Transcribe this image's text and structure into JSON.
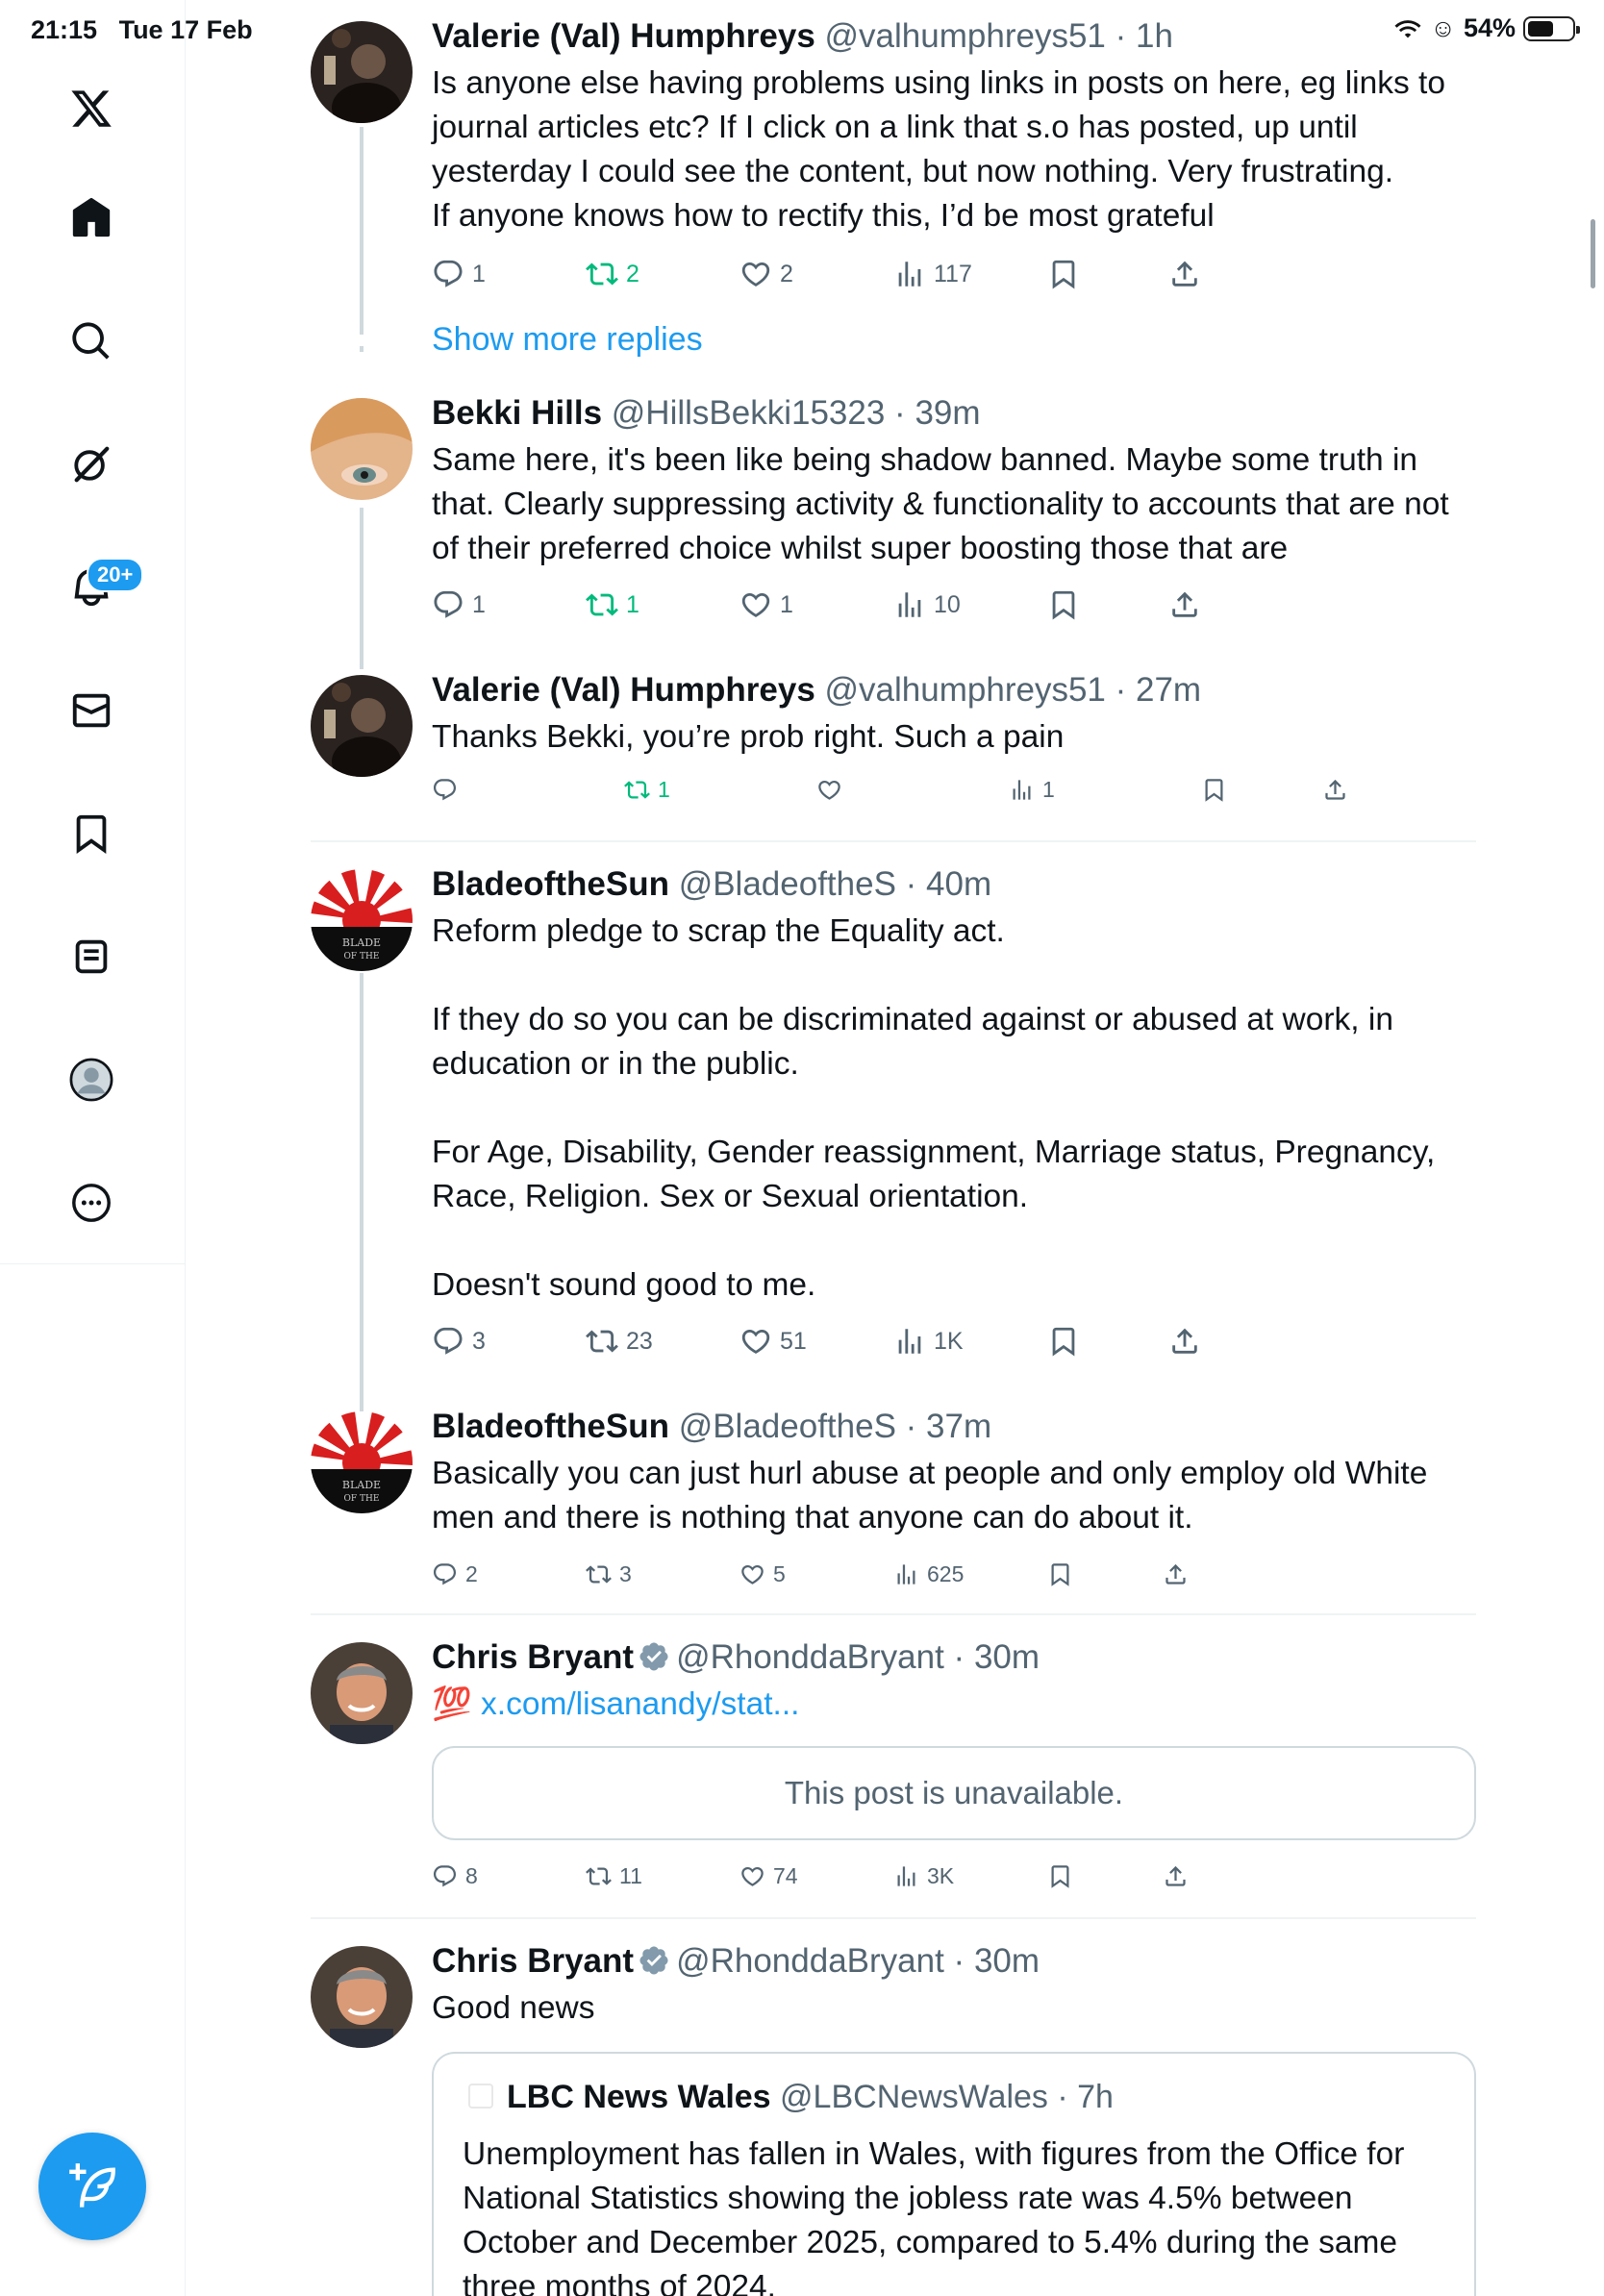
{
  "status": {
    "time": "21:15",
    "date": "Tue 17 Feb",
    "battery": "54%"
  },
  "sidebar": {
    "items": [
      "x-logo",
      "home",
      "explore",
      "grok",
      "notifications",
      "messages",
      "bookmarks",
      "lists",
      "profile",
      "more"
    ],
    "notifications_badge": "20+"
  },
  "posts": [
    {
      "name": "Valerie (Val) Humphreys",
      "handle": "@valhumphreys51",
      "time": "1h",
      "text": "Is anyone else having problems using links in posts on here, eg links to journal articles etc? If I click on a link that s.o has posted, up until yesterday I could see the content, but now nothing. Very frustrating.\nIf anyone knows how to rectify this, I’d be most grateful",
      "replies": "1",
      "reposts": "2",
      "likes": "2",
      "views": "117"
    },
    {
      "show_more": "Show more replies"
    },
    {
      "name": "Bekki Hills",
      "handle": "@HillsBekki15323",
      "time": "39m",
      "text": "Same here, it's been like being shadow banned. Maybe some truth in that. Clearly suppressing activity & functionality to accounts that are not of their preferred choice whilst super boosting those that are",
      "replies": "1",
      "reposts": "1",
      "likes": "1",
      "views": "10"
    },
    {
      "name": "Valerie (Val) Humphreys",
      "handle": "@valhumphreys51",
      "time": "27m",
      "text": "Thanks Bekki, you’re prob right. Such a pain",
      "replies": "",
      "reposts": "1",
      "likes": "",
      "views": "1"
    },
    {
      "name": "BladeoftheSun",
      "handle": "@BladeoftheS",
      "time": "40m",
      "text": "Reform pledge to scrap the Equality act.\n\nIf they do so you can be discriminated against or abused at work, in education or in the public.\n\nFor Age, Disability, Gender reassignment, Marriage status, Pregnancy, Race, Religion. Sex or Sexual orientation.\n\nDoesn't sound good to me.",
      "replies": "3",
      "reposts": "23",
      "likes": "51",
      "views": "1K"
    },
    {
      "name": "BladeoftheSun",
      "handle": "@BladeoftheS",
      "time": "37m",
      "text": "Basically you can just hurl abuse at people and only employ old White men and there is nothing that anyone can do about it.",
      "replies": "2",
      "reposts": "3",
      "likes": "5",
      "views": "625"
    },
    {
      "name": "Chris Bryant",
      "handle": "@RhonddaBryant",
      "time": "30m",
      "emoji": "💯",
      "link": "x.com/lisanandy/stat...",
      "unavailable": "This post is unavailable.",
      "replies": "8",
      "reposts": "11",
      "likes": "74",
      "views": "3K"
    },
    {
      "name": "Chris Bryant",
      "handle": "@RhonddaBryant",
      "time": "30m",
      "text": "Good news",
      "quote": {
        "name": "LBC News Wales",
        "handle": "@LBCNewsWales",
        "time": "7h",
        "text": "Unemployment has fallen in Wales, with figures from the Office for National Statistics showing the jobless rate was 4.5% between October and December 2025, compared to 5.4% during the same three months of 2024."
      }
    }
  ],
  "sep": " · ",
  "colors": {
    "accent": "#1d9bf0",
    "repost": "#00ba7c",
    "muted": "#536471"
  }
}
